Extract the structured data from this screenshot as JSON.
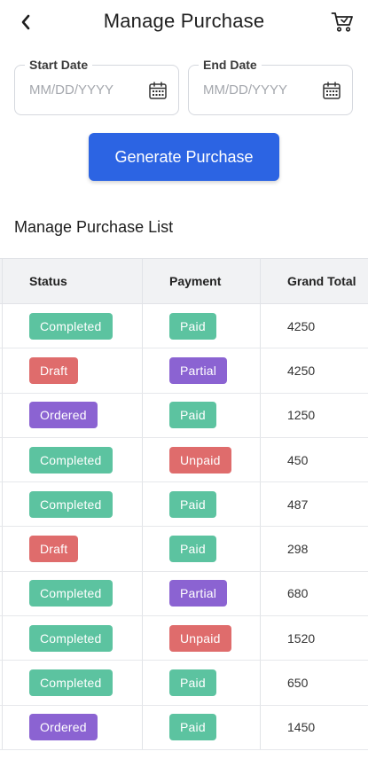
{
  "header": {
    "title": "Manage Purchase"
  },
  "filters": {
    "start": {
      "label": "Start Date",
      "placeholder": "MM/DD/YYYY"
    },
    "end": {
      "label": "End Date",
      "placeholder": "MM/DD/YYYY"
    }
  },
  "generate_label": "Generate Purchase",
  "list_title": "Manage Purchase List",
  "table": {
    "columns": [
      "Status",
      "Payment",
      "Grand Total"
    ],
    "rows": [
      {
        "status": "Completed",
        "payment": "Paid",
        "total": "4250"
      },
      {
        "status": "Draft",
        "payment": "Partial",
        "total": "4250"
      },
      {
        "status": "Ordered",
        "payment": "Paid",
        "total": "1250"
      },
      {
        "status": "Completed",
        "payment": "Unpaid",
        "total": "450"
      },
      {
        "status": "Completed",
        "payment": "Paid",
        "total": "487"
      },
      {
        "status": "Draft",
        "payment": "Paid",
        "total": "298"
      },
      {
        "status": "Completed",
        "payment": "Partial",
        "total": "680"
      },
      {
        "status": "Completed",
        "payment": "Unpaid",
        "total": "1520"
      },
      {
        "status": "Completed",
        "payment": "Paid",
        "total": "650"
      },
      {
        "status": "Ordered",
        "payment": "Paid",
        "total": "1450"
      }
    ]
  },
  "badge_colors": {
    "Completed": "#5cc3a0",
    "Paid": "#5cc3a0",
    "Draft": "#df6c6c",
    "Unpaid": "#df6c6c",
    "Ordered": "#8b63d2",
    "Partial": "#8b63d2"
  },
  "colors": {
    "primary": "#2c64e3",
    "header_bg": "#f1f2f4"
  },
  "icons": {
    "back": "chevron-left-icon",
    "cart": "cart-icon",
    "calendar": "calendar-icon"
  }
}
